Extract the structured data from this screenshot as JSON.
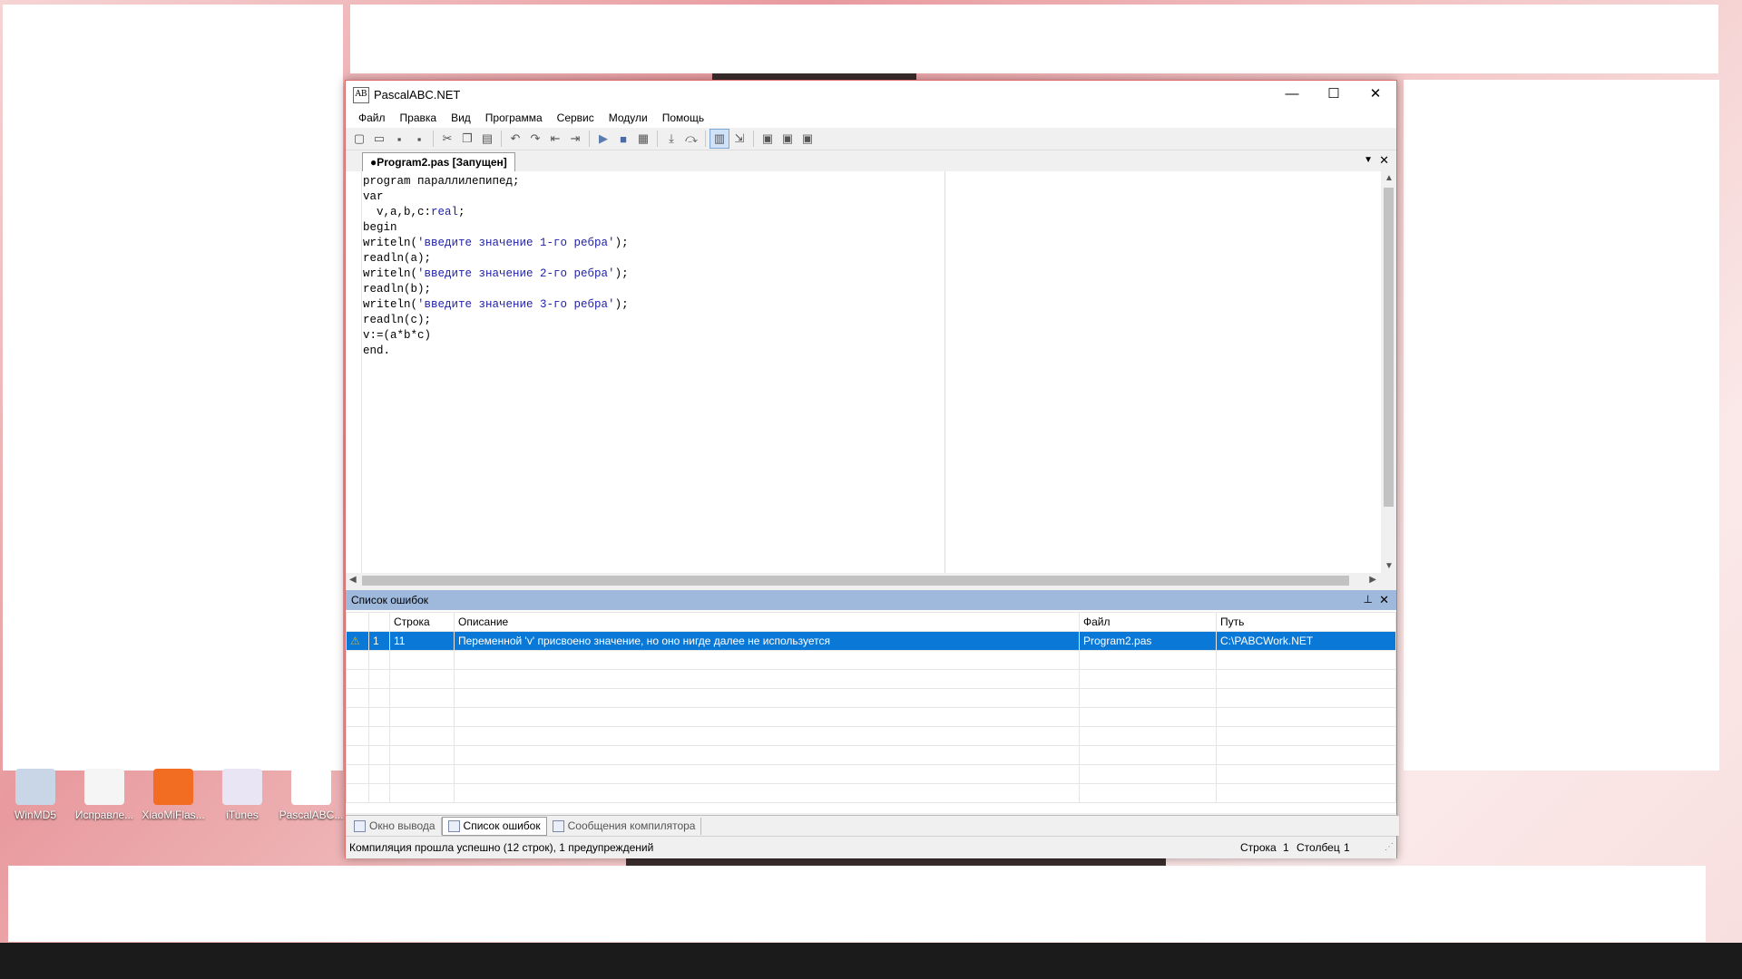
{
  "window": {
    "title": "PascalABC.NET",
    "controls": {
      "minimize": "—",
      "maximize": "☐",
      "close": "✕"
    }
  },
  "menu": [
    "Файл",
    "Правка",
    "Вид",
    "Программа",
    "Сервис",
    "Модули",
    "Помощь"
  ],
  "toolbar_icons": [
    "new-file-icon",
    "open-icon",
    "save-icon",
    "save-all-icon",
    "cut-icon",
    "copy-icon",
    "paste-icon",
    "undo-icon",
    "redo-icon",
    "unindent-icon",
    "indent-icon",
    "run-icon",
    "stop-icon",
    "debug-icon",
    "step-into-icon",
    "step-over-icon",
    "toggle-output-icon",
    "goto-icon",
    "module-1-icon",
    "module-2-icon",
    "module-3-icon"
  ],
  "tab": {
    "label": "●Program2.pas [Запущен]"
  },
  "code": [
    [
      {
        "t": "program параллилепипед;",
        "c": "kw"
      }
    ],
    [
      {
        "t": "var",
        "c": "kw"
      }
    ],
    [
      {
        "t": "  v,a,b,c:",
        "c": "kw"
      },
      {
        "t": "real",
        "c": "typ"
      },
      {
        "t": ";",
        "c": "kw"
      }
    ],
    [
      {
        "t": "begin",
        "c": "kw"
      }
    ],
    [
      {
        "t": "writeln(",
        "c": "kw"
      },
      {
        "t": "'введите значение 1-го ребра'",
        "c": "str"
      },
      {
        "t": ");",
        "c": "kw"
      }
    ],
    [
      {
        "t": "readln(a);",
        "c": "kw"
      }
    ],
    [
      {
        "t": "writeln(",
        "c": "kw"
      },
      {
        "t": "'введите значение 2-го ребра'",
        "c": "str"
      },
      {
        "t": ");",
        "c": "kw"
      }
    ],
    [
      {
        "t": "readln(b);",
        "c": "kw"
      }
    ],
    [
      {
        "t": "writeln(",
        "c": "kw"
      },
      {
        "t": "'введите значение 3-го ребра'",
        "c": "str"
      },
      {
        "t": ");",
        "c": "kw"
      }
    ],
    [
      {
        "t": "readln(c);",
        "c": "kw"
      }
    ],
    [
      {
        "t": "v:=(a*b*c)",
        "c": "kw"
      }
    ],
    [
      {
        "t": "end.",
        "c": "kw"
      }
    ]
  ],
  "errors_panel": {
    "title": "Список ошибок",
    "columns": [
      "",
      "",
      "Строка",
      "Описание",
      "Файл",
      "Путь"
    ],
    "rows": [
      {
        "icon": "⚠",
        "num": "1",
        "line": "11",
        "description": "Переменной 'v' присвоено значение, но оно нигде далее не используется",
        "file": "Program2.pas",
        "path": "C:\\PABCWork.NET"
      }
    ]
  },
  "bottom_tabs": [
    {
      "label": "Окно вывода",
      "active": false
    },
    {
      "label": "Список ошибок",
      "active": true
    },
    {
      "label": "Сообщения компилятора",
      "active": false
    }
  ],
  "status": {
    "message": "Компиляция прошла успешно (12 строк), 1 предупреждений",
    "row_label": "Строка",
    "row_value": "1",
    "col_label": "Столбец",
    "col_value": "1"
  },
  "desktop_icons": [
    {
      "label": "WinMD5",
      "color": "#c9d6e8"
    },
    {
      "label": "Исправле...",
      "color": "#f5f5f5"
    },
    {
      "label": "XiaoMiFlas...",
      "color": "#f26d21"
    },
    {
      "label": "iTunes",
      "color": "#e9e5f5"
    },
    {
      "label": "PascalABC...",
      "color": "#ffffff"
    }
  ]
}
